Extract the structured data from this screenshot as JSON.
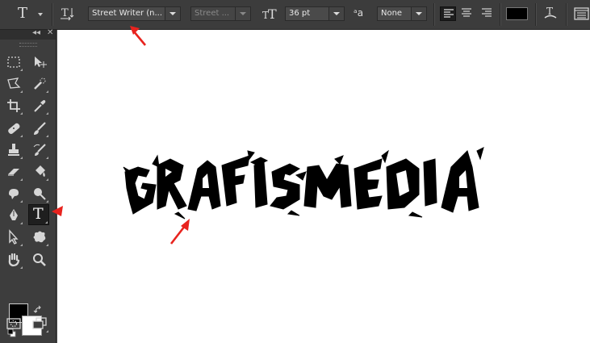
{
  "options_bar": {
    "tool_icon_label": "T",
    "font_family": "Street Writer (n...",
    "font_style": "Street ...",
    "font_size": "36 pt",
    "antialias_label": "ᵃa",
    "antialias": "None",
    "text_color": "#000000"
  },
  "toolbar": {
    "collapse_label": "◂◂",
    "close_label": "✕",
    "type_tool_label": "T",
    "foreground_color": "#000000",
    "background_color": "#ffffff"
  },
  "canvas": {
    "graffiti_text": "GRAFISMEDIA"
  },
  "annotations": {
    "arrow_color": "#e8231e"
  }
}
